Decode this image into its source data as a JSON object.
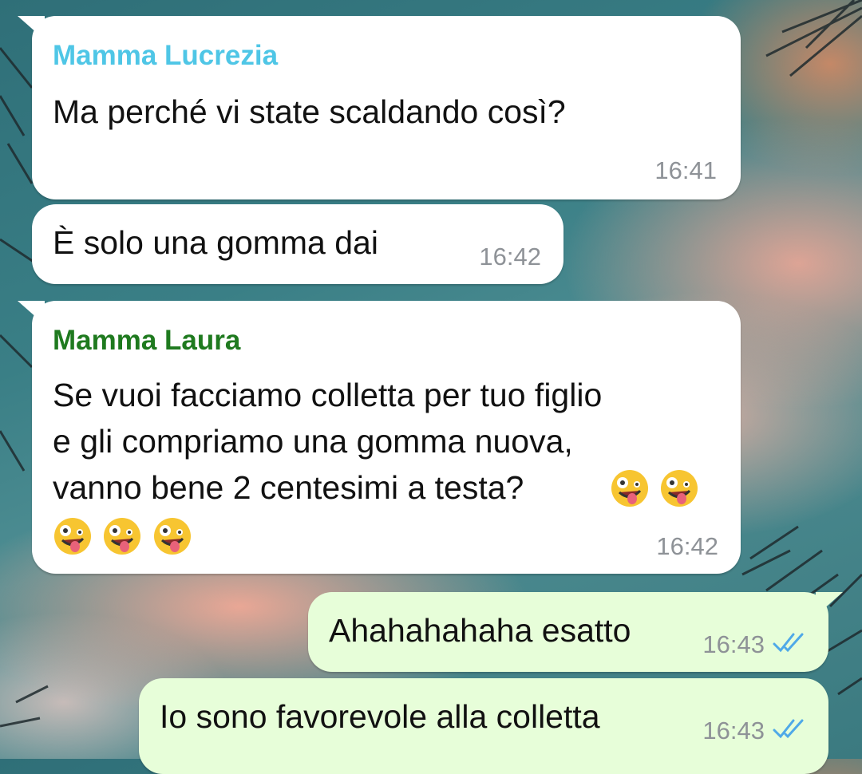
{
  "messages": [
    {
      "sender": "Mamma Lucrezia",
      "sender_color": "#4fc6e6",
      "text": "Ma perché vi state scaldando così?",
      "time": "16:41",
      "direction": "incoming"
    },
    {
      "text": "È solo una gomma dai",
      "time": "16:42",
      "direction": "incoming"
    },
    {
      "sender": "Mamma Laura",
      "sender_color": "#1f7a1f",
      "text_lines": [
        "Se vuoi facciamo colletta per tuo figlio",
        "e gli compriamo una gomma nuova,",
        "vanno bene 2 centesimi a testa?"
      ],
      "emoji": "zany-face-emoji",
      "time": "16:42",
      "direction": "incoming"
    },
    {
      "text": "Ahahahahaha esatto",
      "time": "16:43",
      "direction": "outgoing",
      "status": "read-double-check-icon"
    },
    {
      "text": "Io sono favorevole alla colletta",
      "time": "16:43",
      "direction": "outgoing",
      "status": "read-double-check-icon"
    }
  ],
  "colors": {
    "incoming_bubble": "#ffffff",
    "outgoing_bubble": "#e7fed9",
    "read_ticks": "#4fa9e8",
    "time": "#8e9297"
  }
}
